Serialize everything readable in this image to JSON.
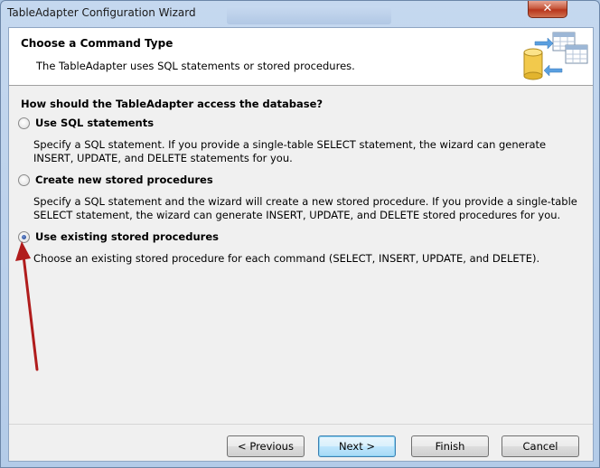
{
  "window": {
    "title": "TableAdapter Configuration Wizard",
    "close_glyph": "✕"
  },
  "header": {
    "title": "Choose a Command Type",
    "subtitle": "The TableAdapter uses SQL statements or stored procedures.",
    "icon": "database-table-icon"
  },
  "question": "How should the TableAdapter access the database?",
  "options": [
    {
      "label": "Use SQL statements",
      "description": "Specify a SQL statement. If you provide a single-table SELECT statement, the wizard can generate INSERT, UPDATE, and DELETE statements for you.",
      "checked": false
    },
    {
      "label": "Create new stored procedures",
      "description": "Specify a SQL statement and the wizard will create a new stored procedure. If you provide a single-table SELECT statement, the wizard can generate INSERT, UPDATE, and DELETE stored procedures for you.",
      "checked": false
    },
    {
      "label": "Use existing stored procedures",
      "description": "Choose an existing stored procedure for each command (SELECT, INSERT, UPDATE, and DELETE).",
      "checked": true
    }
  ],
  "buttons": {
    "previous": "< Previous",
    "next": "Next >",
    "finish": "Finish",
    "cancel": "Cancel"
  },
  "colors": {
    "annotation_arrow": "#b01c1c"
  }
}
